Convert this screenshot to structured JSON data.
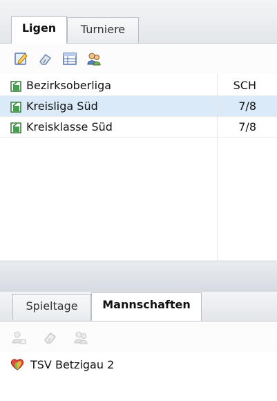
{
  "top_tabs": {
    "active": "Ligen",
    "inactive": "Turniere"
  },
  "top_toolbar": {
    "icons": [
      "edit-icon",
      "eraser-icon",
      "table-icon",
      "users-icon"
    ]
  },
  "leagues": [
    {
      "name": "Bezirksoberliga",
      "code": "SCH",
      "selected": false
    },
    {
      "name": "Kreisliga Süd",
      "code": "7/8",
      "selected": true
    },
    {
      "name": "Kreisklasse Süd",
      "code": "7/8",
      "selected": false
    }
  ],
  "bottom_tabs": {
    "inactive": "Spieltage",
    "active": "Mannschaften"
  },
  "bottom_toolbar": {
    "icons": [
      "add-team-icon",
      "eraser-icon",
      "team-members-icon"
    ]
  },
  "teams": [
    {
      "name": "TSV Betzigau 2"
    }
  ],
  "colors": {
    "selection": "#daeaf8",
    "toolbar_bg": "#fcfcfc"
  }
}
